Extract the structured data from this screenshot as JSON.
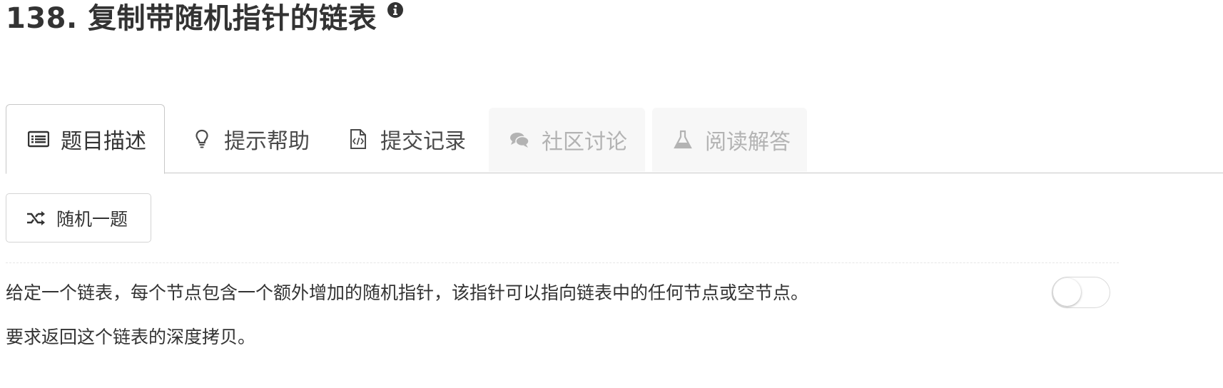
{
  "problem": {
    "title": "138. 复制带随机指针的链表"
  },
  "tabs": [
    {
      "label": "题目描述",
      "icon": "list-icon",
      "state": "active"
    },
    {
      "label": "提示帮助",
      "icon": "lightbulb-icon",
      "state": "normal"
    },
    {
      "label": "提交记录",
      "icon": "code-file-icon",
      "state": "normal"
    },
    {
      "label": "社区讨论",
      "icon": "comments-icon",
      "state": "disabled"
    },
    {
      "label": "阅读解答",
      "icon": "flask-icon",
      "state": "disabled"
    }
  ],
  "random_button": {
    "label": "随机一题",
    "icon": "shuffle-icon"
  },
  "description": {
    "paragraphs": [
      "给定一个链表，每个节点包含一个额外增加的随机指针，该指针可以指向链表中的任何节点或空节点。",
      "要求返回这个链表的深度拷贝。"
    ]
  },
  "toggle": {
    "state": "off"
  },
  "colors": {
    "text": "#333333",
    "border": "#c8c8c8",
    "disabled_text": "#b3b3b3",
    "disabled_bg": "#f7f7f7"
  }
}
